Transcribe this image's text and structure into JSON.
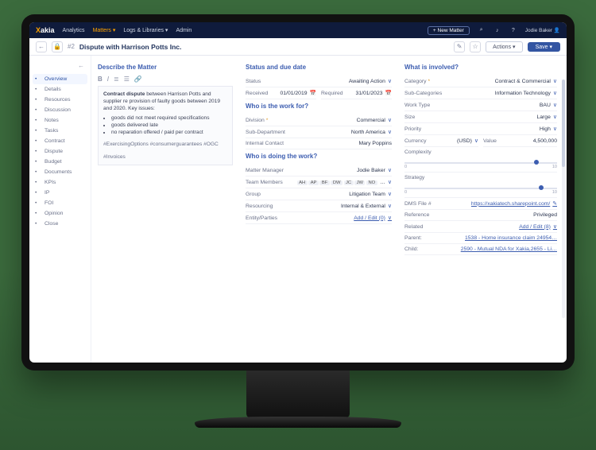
{
  "brand": {
    "pre": "X",
    "name": "akia"
  },
  "nav": {
    "items": [
      "Analytics",
      "Matters",
      "Logs & Libraries",
      "Admin"
    ],
    "active_index": 1,
    "new_matter": "+ New Matter",
    "user": "Jodie Baker"
  },
  "toolbar": {
    "matter_no": "#2",
    "title": "Dispute with Harrison Potts Inc.",
    "actions": "Actions",
    "save": "Save"
  },
  "sidebar": {
    "items": [
      {
        "icon": "overview-icon",
        "label": "Overview",
        "active": true
      },
      {
        "icon": "details-icon",
        "label": "Details"
      },
      {
        "icon": "resources-icon",
        "label": "Resources"
      },
      {
        "icon": "discussion-icon",
        "label": "Discussion"
      },
      {
        "icon": "notes-icon",
        "label": "Notes"
      },
      {
        "icon": "tasks-icon",
        "label": "Tasks"
      },
      {
        "icon": "contract-icon",
        "label": "Contract"
      },
      {
        "icon": "dispute-icon",
        "label": "Dispute"
      },
      {
        "icon": "budget-icon",
        "label": "Budget"
      },
      {
        "icon": "documents-icon",
        "label": "Documents"
      },
      {
        "icon": "kpis-icon",
        "label": "KPIs"
      },
      {
        "icon": "ip-icon",
        "label": "IP"
      },
      {
        "icon": "foi-icon",
        "label": "FOI"
      },
      {
        "icon": "opinion-icon",
        "label": "Opinion"
      },
      {
        "icon": "close-icon",
        "label": "Close"
      }
    ]
  },
  "describe": {
    "heading": "Describe the Matter",
    "body_bold": "Contract dispute",
    "body_rest": " between Harrison Potts and supplier re provision of faulty goods between 2019 and 2020. Key issues:",
    "bullets": [
      "goods did not meet required specifications",
      "goods delivered late",
      "no reparation offered / paid per contract"
    ],
    "tags1": "#ExercisingOptions #consumerguarantees #OGC",
    "tags2": "#Invoices"
  },
  "status": {
    "heading": "Status and due date",
    "status_label": "Status",
    "status_value": "Awaiting Action",
    "received_label": "Received",
    "received_value": "01/01/2019",
    "required_label": "Required",
    "required_value": "31/01/2023"
  },
  "workfor": {
    "heading": "Who is the work for?",
    "division_label": "Division",
    "division_value": "Commercial",
    "subdept_label": "Sub-Department",
    "subdept_value": "North America",
    "contact_label": "Internal Contact",
    "contact_value": "Mary Poppins"
  },
  "doing": {
    "heading": "Who is doing the work?",
    "mgr_label": "Matter Manager",
    "mgr_value": "Jodie Baker",
    "team_label": "Team Members",
    "team_chips": [
      "AH",
      "AP",
      "BF",
      "DW",
      "JC",
      "JW",
      "NO"
    ],
    "group_label": "Group",
    "group_value": "Litigation Team",
    "resourcing_label": "Resourcing",
    "resourcing_value": "Internal & External",
    "entity_label": "Entity/Parties",
    "entity_value": "Add / Edit (0)"
  },
  "involved": {
    "heading": "What is involved?",
    "category_label": "Category",
    "category_value": "Contract & Commercial",
    "subcat_label": "Sub-Categories",
    "subcat_value": "Information Technology",
    "worktype_label": "Work Type",
    "worktype_value": "BAU",
    "size_label": "Size",
    "size_value": "Large",
    "priority_label": "Priority",
    "priority_value": "High",
    "currency_label": "Currency",
    "currency_value": "(USD)",
    "value_label": "Value",
    "value_value": "4,500,000",
    "complexity_label": "Complexity",
    "complexity_min": "0",
    "complexity_max": "10",
    "complexity_pos": 0.85,
    "strategy_label": "Strategy",
    "strategy_min": "0",
    "strategy_max": "10",
    "strategy_pos": 0.88,
    "dms_label": "DMS File #",
    "dms_value": "https://xakiatech.sharepoint.com/",
    "reference_label": "Reference",
    "reference_value": "Privileged",
    "related_label": "Related",
    "related_value": "Add / Edit (8)",
    "parent_label": "Parent:",
    "parent_value": "1538 - Home insurance claim 24954…",
    "child_label": "Child:",
    "child_value": "2590 - Mutual NDA for Xakia,2655 - Li…"
  }
}
